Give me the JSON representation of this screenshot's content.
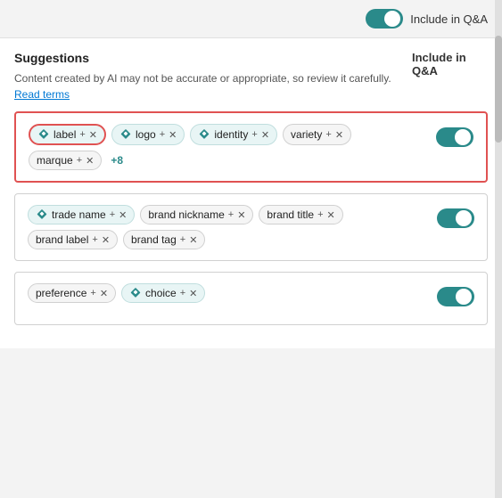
{
  "topBar": {
    "toggleLabel": "Include in Q&A",
    "toggleOn": true
  },
  "suggestions": {
    "title": "Suggestions",
    "description": "Content created by AI may not be accurate or appropriate, so review it carefully.",
    "readTerms": "Read terms",
    "includeQnaLabel": "Include in Q&A"
  },
  "cards": [
    {
      "id": "card-1",
      "highlighted": true,
      "toggleOn": true,
      "tags": [
        {
          "type": "ai",
          "text": "label",
          "hasPlus": true,
          "hasX": true
        },
        {
          "type": "ai",
          "text": "logo",
          "hasPlus": true,
          "hasX": true
        },
        {
          "type": "ai",
          "text": "identity",
          "hasPlus": true,
          "hasX": true
        },
        {
          "type": "plain",
          "text": "variety",
          "hasPlus": true,
          "hasX": true
        },
        {
          "type": "plain",
          "text": "marque",
          "hasPlus": true,
          "hasX": true
        },
        {
          "type": "more",
          "text": "+8"
        }
      ]
    },
    {
      "id": "card-2",
      "highlighted": false,
      "toggleOn": true,
      "tags": [
        {
          "type": "ai",
          "text": "trade name",
          "hasPlus": true,
          "hasX": true
        },
        {
          "type": "plain",
          "text": "brand nickname",
          "hasPlus": true,
          "hasX": true
        },
        {
          "type": "plain",
          "text": "brand title",
          "hasPlus": true,
          "hasX": true
        },
        {
          "type": "plain",
          "text": "brand label",
          "hasPlus": true,
          "hasX": true
        },
        {
          "type": "plain",
          "text": "brand tag",
          "hasPlus": true,
          "hasX": true
        }
      ]
    },
    {
      "id": "card-3",
      "highlighted": false,
      "toggleOn": true,
      "tags": [
        {
          "type": "plain",
          "text": "preference",
          "hasPlus": true,
          "hasX": true
        },
        {
          "type": "ai",
          "text": "choice",
          "hasPlus": true,
          "hasX": true
        }
      ]
    }
  ]
}
